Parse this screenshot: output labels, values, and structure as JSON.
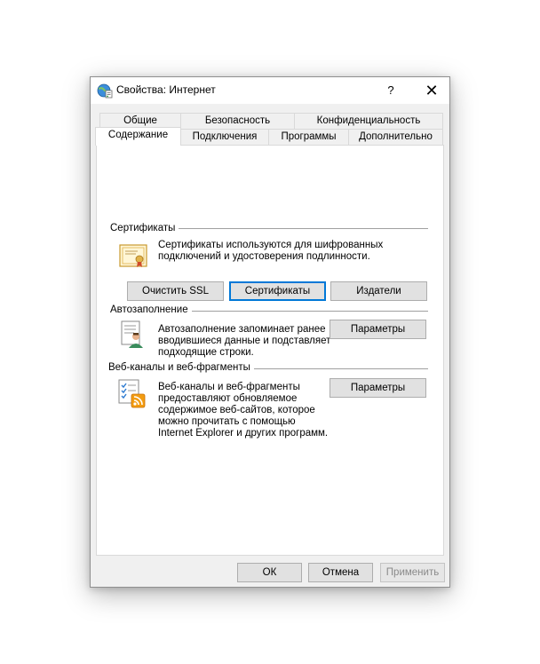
{
  "window": {
    "title": "Свойства: Интернет",
    "help_label": "?",
    "close_label": "✕"
  },
  "tabs": {
    "row1": [
      {
        "label": "Общие"
      },
      {
        "label": "Безопасность"
      },
      {
        "label": "Конфиденциальность"
      }
    ],
    "row2": [
      {
        "label": "Содержание",
        "active": true
      },
      {
        "label": "Подключения"
      },
      {
        "label": "Программы"
      },
      {
        "label": "Дополнительно"
      }
    ]
  },
  "certificates": {
    "heading": "Сертификаты",
    "description_line1": "Сертификаты используются для шифрованных",
    "description_line2": "подключений и удостоверения подлинности.",
    "icon": "certificate-icon",
    "buttons": {
      "clear_ssl": "Очистить SSL",
      "certificates": "Сертификаты",
      "publishers": "Издатели"
    }
  },
  "autocomplete": {
    "heading": "Автозаполнение",
    "description_line1": "Автозаполнение запоминает ранее",
    "description_line2": "вводившиеся данные и подставляет",
    "description_line3": "подходящие строки.",
    "icon": "autocomplete-form-icon",
    "settings_button": "Параметры"
  },
  "feeds": {
    "heading": "Веб-каналы и веб-фрагменты",
    "description_line1": "Веб-каналы и веб-фрагменты",
    "description_line2": "предоставляют обновляемое",
    "description_line3": "содержимое веб-сайтов, которое",
    "description_line4": "можно прочитать с помощью",
    "description_line5": "Internet Explorer и других программ.",
    "icon": "rss-feed-icon",
    "settings_button": "Параметры"
  },
  "footer": {
    "ok": "ОК",
    "cancel": "Отмена",
    "apply": "Применить"
  },
  "colors": {
    "focus_border": "#0078d7",
    "rss_orange": "#f39c12",
    "certificate_gold": "#e0b24a"
  }
}
